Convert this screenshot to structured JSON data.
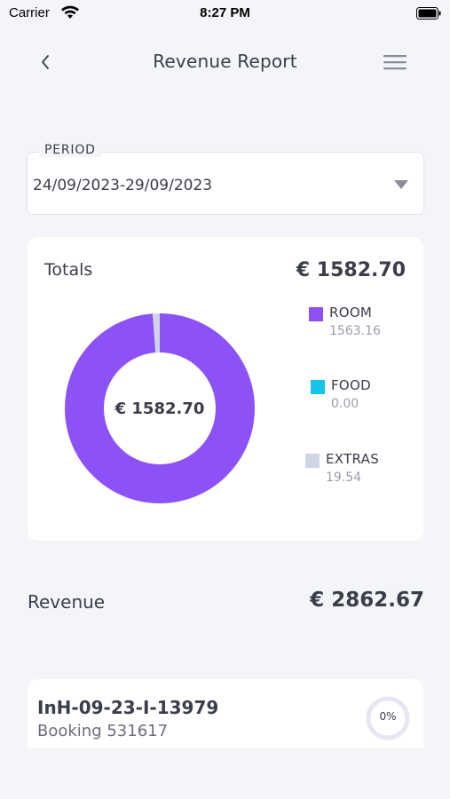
{
  "status_bar": {
    "carrier": "Carrier",
    "time": "8:27 PM"
  },
  "nav": {
    "title": "Revenue Report",
    "back_icon": "chevron-left-icon",
    "menu_icon": "hamburger-menu-icon"
  },
  "period": {
    "label": "PERIOD",
    "value": "24/09/2023-29/09/2023"
  },
  "totals": {
    "label": "Totals",
    "amount": "€ 1582.70",
    "center_label": "€ 1582.70",
    "legend": [
      {
        "name": "ROOM",
        "value": "1563.16",
        "color": "#8c52f8"
      },
      {
        "name": "FOOD",
        "value": "0.00",
        "color": "#14c4ea"
      },
      {
        "name": "EXTRAS",
        "value": "19.54",
        "color": "#cfd5e4"
      }
    ]
  },
  "chart_data": {
    "type": "pie",
    "categories": [
      "ROOM",
      "FOOD",
      "EXTRAS"
    ],
    "values": [
      1563.16,
      0.0,
      19.54
    ],
    "colors": [
      "#8c52f8",
      "#14c4ea",
      "#cfd5e4"
    ],
    "donut": true
  },
  "revenue": {
    "label": "Revenue",
    "amount": "€ 2862.67"
  },
  "bookings": [
    {
      "id": "InH-09-23-I-13979",
      "subtitle": "Booking 531617",
      "progress": 0,
      "progress_label": "0%"
    }
  ]
}
